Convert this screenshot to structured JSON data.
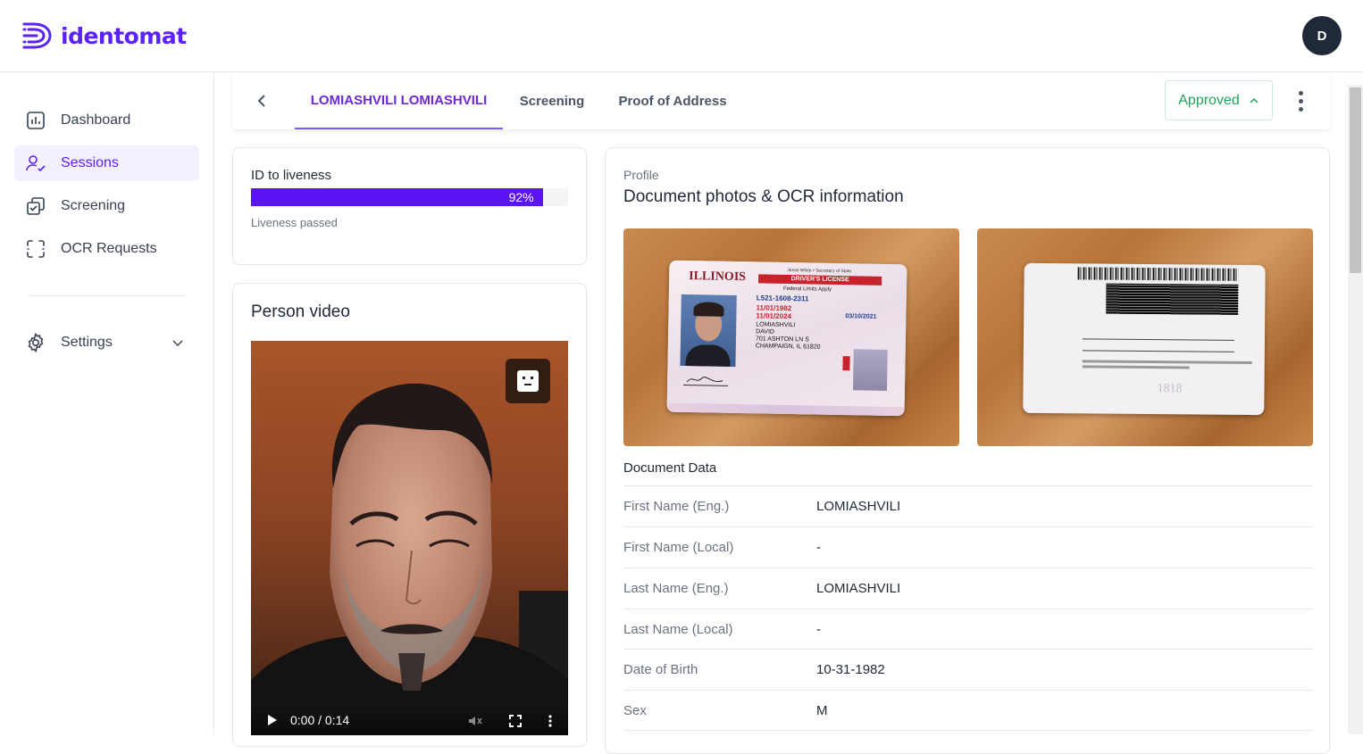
{
  "app": {
    "name": "identomat"
  },
  "user": {
    "initial": "D"
  },
  "sidebar": {
    "items": [
      {
        "label": "Dashboard"
      },
      {
        "label": "Sessions"
      },
      {
        "label": "Screening"
      },
      {
        "label": "OCR Requests"
      }
    ],
    "settings_label": "Settings"
  },
  "tabs": {
    "items": [
      {
        "label": "LOMIASHVILI LOMIASHVILI"
      },
      {
        "label": "Screening"
      },
      {
        "label": "Proof of Address"
      }
    ],
    "status_label": "Approved"
  },
  "liveness": {
    "title": "ID to liveness",
    "percent": 92,
    "percent_label": "92%",
    "status": "Liveness passed"
  },
  "video": {
    "title": "Person video",
    "time": "0:00 / 0:14"
  },
  "profile": {
    "section": "Profile",
    "title": "Document photos & OCR information",
    "document_data_title": "Document Data",
    "front_card": {
      "state": "ILLINOIS",
      "header": "Jesse White • Secretary of State",
      "type": "DRIVER'S LICENSE",
      "federal": "Federal Limits Apply",
      "number": "L521-1608-2311",
      "dob": "11/01/1982",
      "exp": "11/01/2024",
      "iss": "03/10/2021",
      "last_name": "LOMIASHVILI",
      "first_name": "DAVID",
      "address1": "701 ASHTON LN S",
      "address2": "CHAMPAIGN, IL 61820"
    },
    "back_card": {
      "year": "1818"
    },
    "fields": [
      {
        "label": "First Name (Eng.)",
        "value": "LOMIASHVILI"
      },
      {
        "label": "First Name (Local)",
        "value": "-"
      },
      {
        "label": "Last Name (Eng.)",
        "value": "LOMIASHVILI"
      },
      {
        "label": "Last Name (Local)",
        "value": "-"
      },
      {
        "label": "Date of Birth",
        "value": "10-31-1982"
      },
      {
        "label": "Sex",
        "value": "M"
      }
    ]
  },
  "colors": {
    "brand": "#5b21f5",
    "approved": "#22a35a",
    "progress": "#5b14f5"
  }
}
